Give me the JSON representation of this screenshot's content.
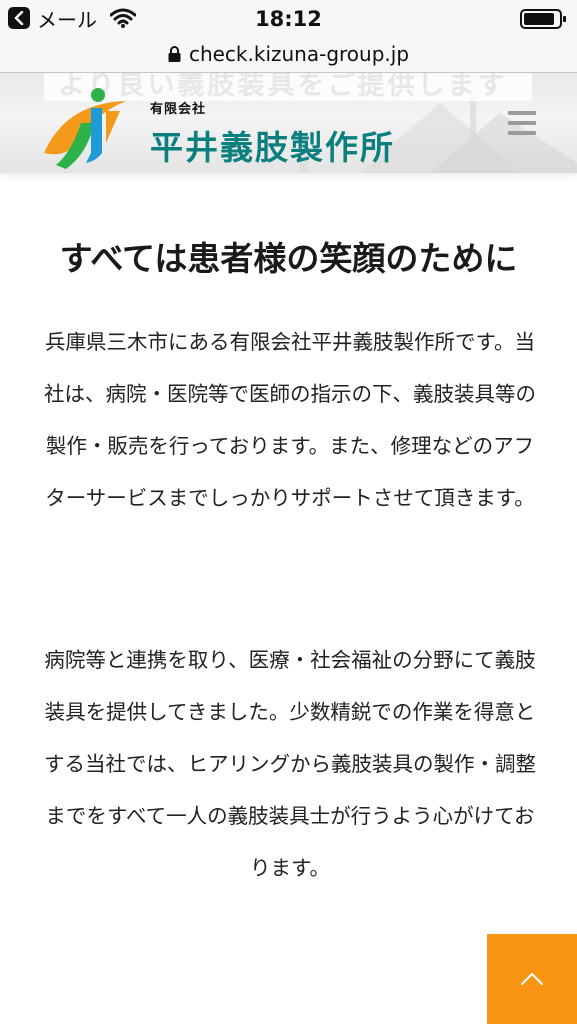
{
  "status_bar": {
    "back_app_label": "メール",
    "time": "18:12",
    "icons": [
      "back-arrow-icon",
      "wifi-icon",
      "battery-icon"
    ]
  },
  "browser": {
    "url": "check.kizuna-group.jp",
    "icons": [
      "lock-icon"
    ]
  },
  "header": {
    "tagline": "より良い義肢装具をご提供します",
    "company_type": "有限会社",
    "company_name": "平井義肢製作所",
    "menu_icon": "hamburger-menu-icon",
    "colors": {
      "brand": "#0b7f7d",
      "logo_orange": "#f39a1a",
      "logo_green": "#2db24a"
    }
  },
  "main": {
    "title": "すべては患者様の笑顔のために",
    "paragraphs": [
      "兵庫県三木市にある有限会社平井義肢製作所です。当社は、病院・医院等で医師の指示の下、義肢装具等の製作・販売を行っております。また、修理などのアフターサービスまでしっかりサポートさせて頂きます。",
      "病院等と連携を取り、医療・社会福祉の分野にて義肢装具を提供してきました。少数精鋭での作業を得意とする当社では、ヒアリングから義肢装具の製作・調整までをすべて一人の義肢装具士が行うよう心がけております。"
    ]
  },
  "back_to_top": {
    "icon": "chevron-up-icon",
    "color": "#f79412"
  }
}
